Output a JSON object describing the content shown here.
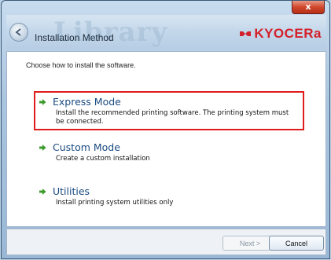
{
  "window": {
    "close_glyph": "x"
  },
  "header": {
    "title": "Installation Method",
    "ghost_text": "Library",
    "logo_text": "KYOCERa",
    "brand_color": "#d3202a",
    "back_icon": "back-arrow-icon"
  },
  "main": {
    "instruction": "Choose how to install the software.",
    "options": [
      {
        "label": "Express Mode",
        "description": "Install the recommended printing software. The printing system must be connected.",
        "highlighted": true
      },
      {
        "label": "Custom Mode",
        "description": "Create a custom installation"
      },
      {
        "label": "Utilities",
        "description": "Install printing system utilities only"
      }
    ]
  },
  "footer": {
    "next_label": "Next >",
    "cancel_label": "Cancel",
    "next_enabled": false
  }
}
